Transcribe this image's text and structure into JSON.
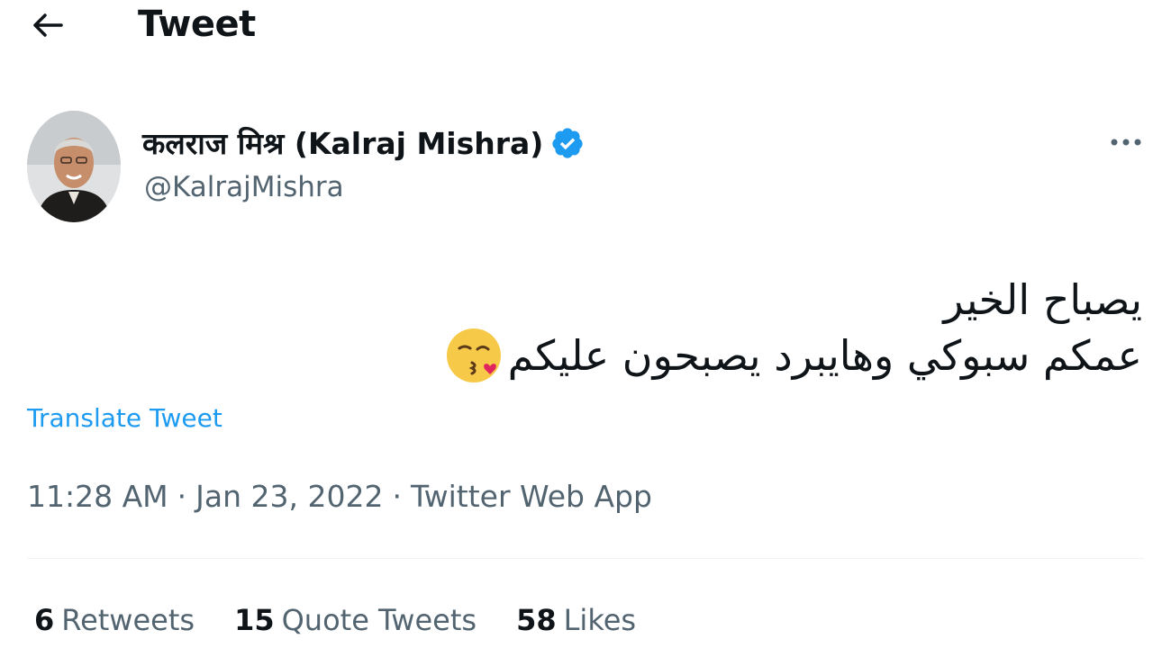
{
  "header": {
    "title": "Tweet",
    "back_icon": "arrow-left-icon"
  },
  "author": {
    "name": "कलराज मिश्र (Kalraj Mishra)",
    "handle": "@KalrajMishra",
    "verified": true,
    "verified_color": "#1d9bf0"
  },
  "tweet": {
    "lines": [
      "يصباح الخير",
      "عمكم سبوكي وهايبرد يصبحون عليكم"
    ],
    "emoji": "kissing-face-emoji",
    "translate_label": "Translate Tweet"
  },
  "meta": {
    "time": "11:28 AM",
    "date": "Jan 23, 2022",
    "separator": "·",
    "source": "Twitter Web App"
  },
  "stats": {
    "retweets": {
      "count": "6",
      "label": "Retweets"
    },
    "quote_tweets": {
      "count": "15",
      "label": "Quote Tweets"
    },
    "likes": {
      "count": "58",
      "label": "Likes"
    }
  },
  "colors": {
    "accent": "#1d9bf0",
    "text_primary": "#0f1419",
    "text_secondary": "#536471",
    "divider": "#eff3f4"
  }
}
